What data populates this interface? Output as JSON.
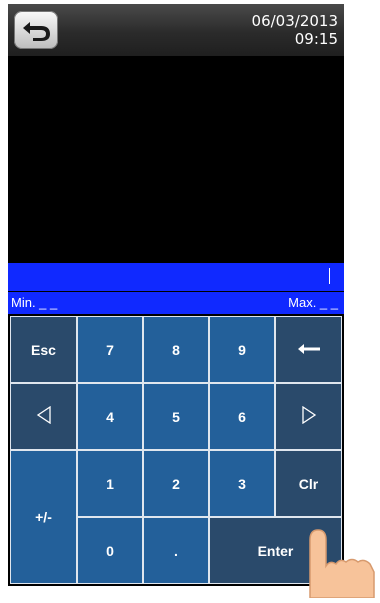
{
  "status": {
    "date": "06/03/2013",
    "time": "09:15"
  },
  "input": {
    "value": ""
  },
  "range": {
    "min_label": "Min. _ _",
    "max_label": "Max. _ _"
  },
  "keys": {
    "esc": "Esc",
    "seven": "7",
    "eight": "8",
    "nine": "9",
    "four": "4",
    "five": "5",
    "six": "6",
    "one": "1",
    "two": "2",
    "three": "3",
    "zero": "0",
    "dot": ".",
    "clr": "Clr",
    "plus_minus": "+/-",
    "enter": "Enter"
  },
  "icons": {
    "back": "back-arrow-icon",
    "backspace": "backspace-arrow-icon",
    "left": "left-triangle-icon",
    "right": "right-triangle-icon"
  },
  "colors": {
    "input_bar": "#1029ff",
    "key_dark": "#2a4a6b",
    "key_blue": "#23609a"
  }
}
